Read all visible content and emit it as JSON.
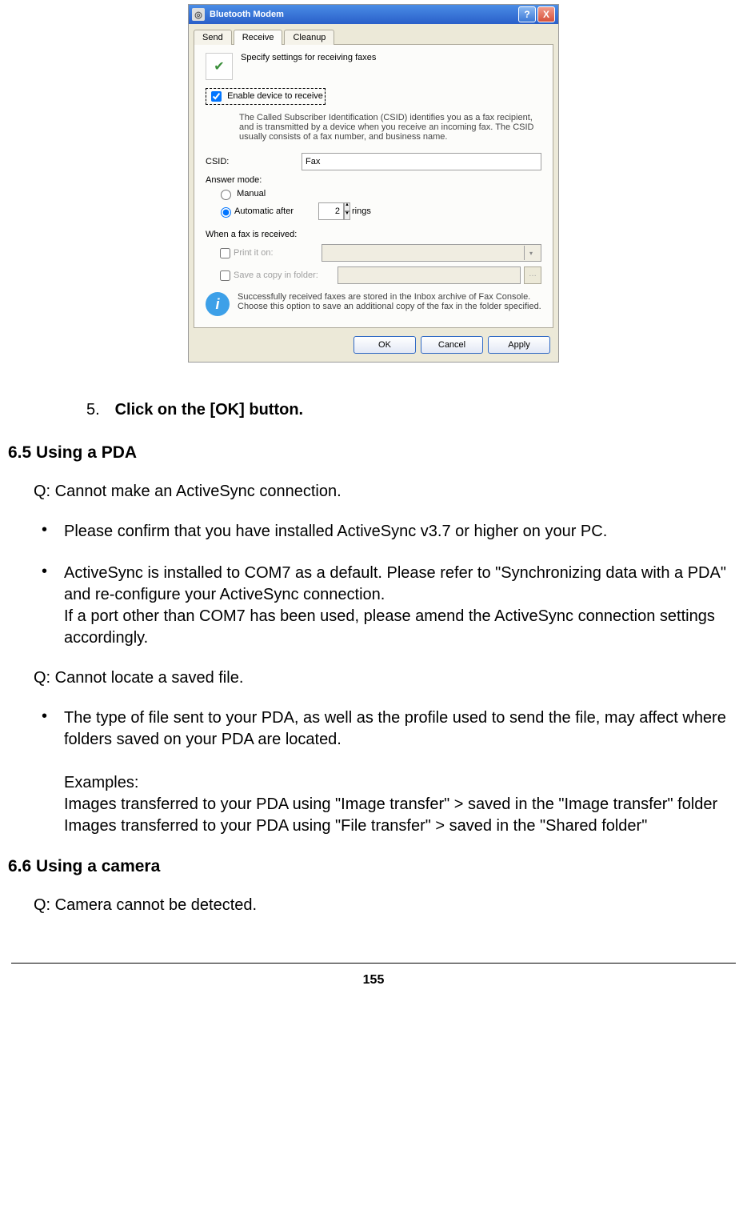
{
  "dialog": {
    "title": "Bluetooth Modem",
    "tabs": {
      "send": "Send",
      "receive": "Receive",
      "cleanup": "Cleanup"
    },
    "header": "Specify settings for receiving faxes",
    "enable": "Enable device to receive",
    "desc": "The Called Subscriber Identification (CSID) identifies you as a fax recipient, and is transmitted by a device when you receive an incoming fax. The CSID usually consists of a fax number, and business name.",
    "csid_label": "CSID:",
    "csid_value": "Fax",
    "answer_mode": "Answer mode:",
    "manual": "Manual",
    "auto_after": "Automatic after",
    "rings_value": "2",
    "rings": "rings",
    "when_received": "When a fax is received:",
    "print_on": "Print it on:",
    "save_copy": "Save a copy in folder:",
    "info_text": "Successfully received faxes are stored in the Inbox archive of Fax Console. Choose this option to save an additional copy of the fax in the folder specified.",
    "ok": "OK",
    "cancel": "Cancel",
    "apply": "Apply"
  },
  "doc": {
    "step5_num": "5.",
    "step5": "Click on the [OK] button.",
    "h65": "6.5  Using a PDA",
    "q1": "Q: Cannot make an ActiveSync connection.",
    "b1": "Please confirm that you have installed ActiveSync v3.7 or higher on your PC.",
    "b2": "ActiveSync is installed to COM7 as a default. Please refer to \"Synchronizing data with a PDA\" and re-configure your ActiveSync connection.\nIf a port other than COM7 has been used, please amend the ActiveSync connection settings accordingly.",
    "q2": "Q: Cannot locate a saved file.",
    "b3": "The type of file sent to your PDA, as well as the profile used to send the file, may affect where folders saved on your PDA are located.",
    "b3_ex_head": "Examples:",
    "b3_ex1": "Images transferred to your PDA using \"Image transfer\" > saved in the \"Image transfer\" folder",
    "b3_ex2": "Images transferred to your PDA using \"File transfer\" > saved in the \"Shared folder\"",
    "h66": "6.6  Using a camera",
    "q3": "Q: Camera cannot be detected.",
    "page_num": "155"
  }
}
